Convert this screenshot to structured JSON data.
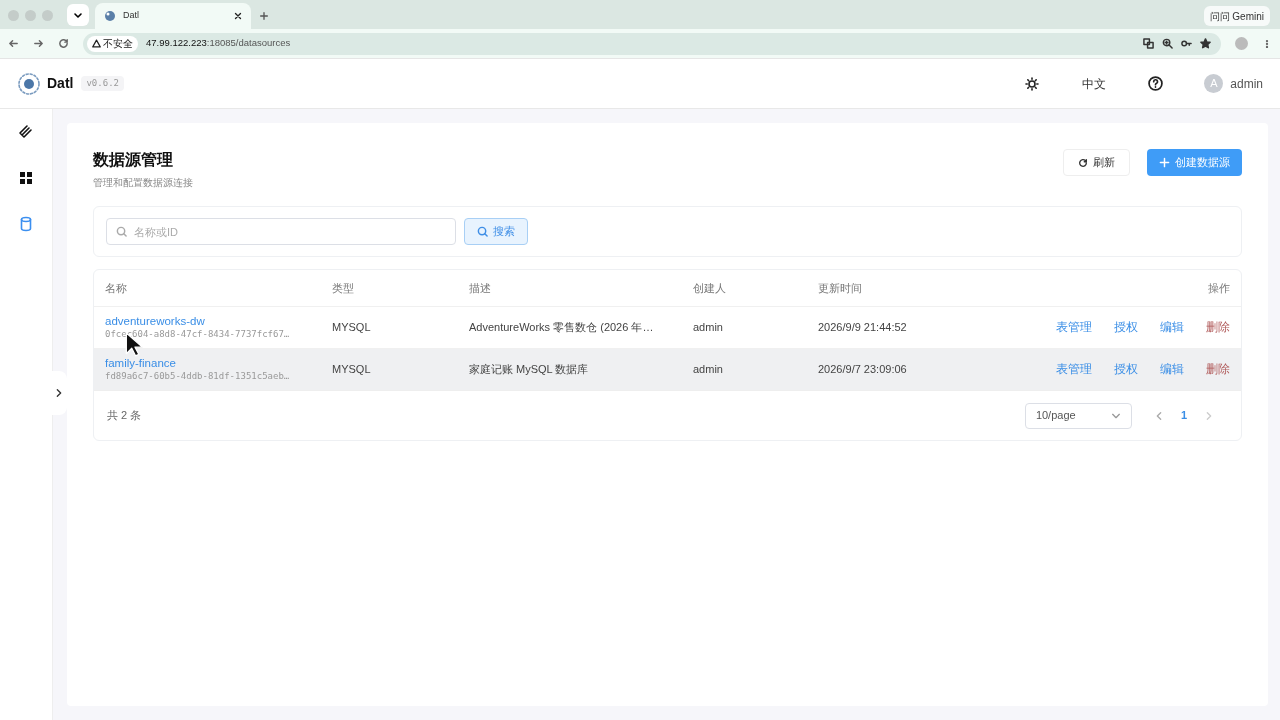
{
  "browser": {
    "tab_title": "Datl",
    "security_label": "不安全",
    "url_host": "47.99.122.223",
    "url_rest": ":18085/datasources",
    "gemini_button": "问问 Gemini"
  },
  "app": {
    "name": "Datl",
    "version": "v0.6.2",
    "language": "中文",
    "user": {
      "initial": "A",
      "name": "admin"
    }
  },
  "sidebar": {
    "items": [
      {
        "kind": "layers",
        "selected": false
      },
      {
        "kind": "grid",
        "selected": false
      },
      {
        "kind": "database",
        "selected": true
      }
    ]
  },
  "page": {
    "title": "数据源管理",
    "subtitle": "管理和配置数据源连接",
    "refresh_button": "刷新",
    "create_button": "创建数据源"
  },
  "search": {
    "placeholder": "名称或ID",
    "button": "搜索"
  },
  "table": {
    "columns": [
      "名称",
      "类型",
      "描述",
      "创建人",
      "更新时间",
      "操作"
    ],
    "rows": [
      {
        "name": "adventureworks-dw",
        "id": "0fcec604-a8d8-47cf-8434-7737fcf67…",
        "type": "MYSQL",
        "description": "AdventureWorks 零售数仓 (2026 年…",
        "creator": "admin",
        "updated": "2026/9/9 21:44:52",
        "actions": [
          "表管理",
          "授权",
          "编辑",
          "删除"
        ],
        "hovered": false
      },
      {
        "name": "family-finance",
        "id": "fd89a6c7-60b5-4ddb-81df-1351c5aeb…",
        "type": "MYSQL",
        "description": "家庭记账 MySQL 数据库",
        "creator": "admin",
        "updated": "2026/9/7 23:09:06",
        "actions": [
          "表管理",
          "授权",
          "编辑",
          "删除"
        ],
        "hovered": true
      }
    ]
  },
  "pagination": {
    "total": "共 2 条",
    "page_size": "10/page",
    "pages": [
      {
        "label": "1",
        "selected": true
      }
    ]
  }
}
